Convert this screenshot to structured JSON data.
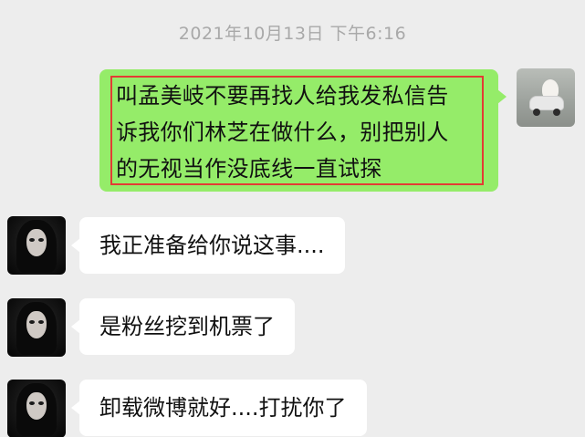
{
  "timestamp": "2021年10月13日 下午6:16",
  "messages": [
    {
      "sender": "self",
      "text": "叫孟美岐不要再找人给我发私信告诉我你们林芝在做什么，别把别人的无视当作没底线一直试探",
      "lines": [
        "叫孟美岐不要再找人给我发私信告",
        "诉我你们林芝在做什么，别把别人",
        "的无视当作没底线一直试探"
      ],
      "highlighted": true
    },
    {
      "sender": "other",
      "text": "我正准备给你说这事...."
    },
    {
      "sender": "other",
      "text": "是粉丝挖到机票了"
    },
    {
      "sender": "other",
      "text": "卸载微博就好....打扰你了"
    }
  ],
  "colors": {
    "background": "#ededed",
    "self_bubble": "#95ec69",
    "other_bubble": "#ffffff",
    "highlight_border": "#e33b34",
    "timestamp_text": "#a9a9a9"
  }
}
